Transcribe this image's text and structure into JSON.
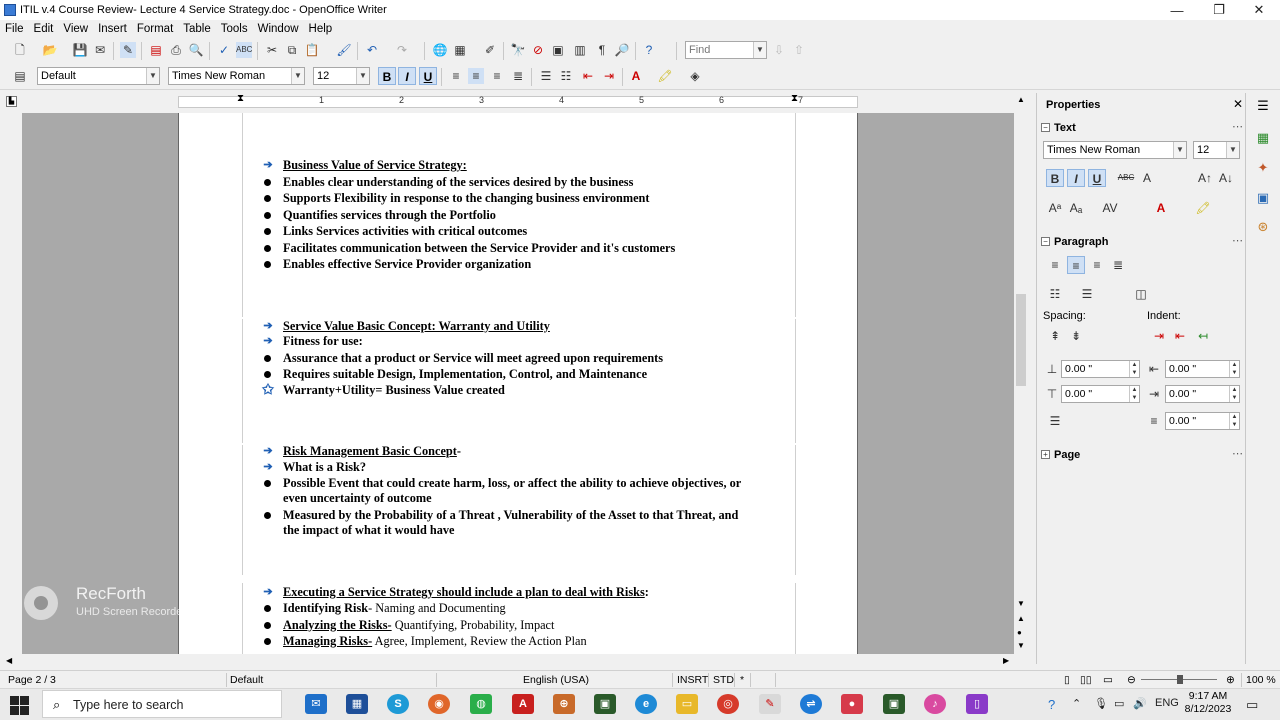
{
  "window": {
    "title": "ITIL v.4 Course Review- Lecture 4 Service Strategy.doc - OpenOffice Writer",
    "minimize": "—",
    "maximize": "❐",
    "close": "✕"
  },
  "menu": [
    "File",
    "Edit",
    "View",
    "Insert",
    "Format",
    "Table",
    "Tools",
    "Window",
    "Help"
  ],
  "toolbar": {
    "find_placeholder": "Find",
    "paragraph_style": "Default",
    "font_name": "Times New Roman",
    "font_size": "12",
    "bold": "B",
    "italic": "I",
    "underline": "U"
  },
  "ruler": {
    "ticks": [
      "1",
      "2",
      "3",
      "4",
      "5",
      "6",
      "7"
    ]
  },
  "document": {
    "sections": [
      {
        "heading": "Business Value of Service Strategy:",
        "items": [
          "Enables clear understanding of the services desired by the business",
          "Supports Flexibility in response to the changing business environment",
          "Quantifies services through the Portfolio",
          "Links Services activities with critical outcomes",
          "Facilitates communication between the Service Provider and it's customers",
          "Enables effective  Service Provider organization"
        ]
      },
      {
        "heading": "Service Value Basic Concept: Warranty and Utility",
        "sub": "Fitness for use:",
        "items": [
          "Assurance that a product or Service will meet agreed upon requirements",
          "Requires suitable Design, Implementation,  Control, and Maintenance"
        ],
        "star": "Warranty+Utility= Business Value created"
      },
      {
        "heading": "Risk Management Basic Concept",
        "heading_suffix": "-",
        "sub": "What is a Risk?",
        "items": [
          "Possible Event that could  create harm, loss, or affect the ability to achieve objectives, or",
          "even uncertainty of outcome",
          "Measured by the Probability of a Threat , Vulnerability of the Asset to that Threat, and",
          "the impact of what it would have"
        ]
      },
      {
        "heading": "Executing a Service Strategy should include a plan to deal with Risks",
        "heading_suffix": ":",
        "items": [
          {
            "term": "Identifying Risk",
            "rest": "- Naming and Documenting"
          },
          {
            "term": "Analyzing the Risks-",
            "rest": "  Quantifying, Probability, Impact"
          },
          {
            "term": "Managing Risks-",
            "rest": " Agree, Implement, Review the Action Plan"
          }
        ]
      }
    ]
  },
  "watermark": {
    "title": "RecForth",
    "subtitle": "UHD Screen Recorder"
  },
  "sidebar": {
    "title": "Properties",
    "text_section": "Text",
    "font_name": "Times New Roman",
    "font_size": "12",
    "paragraph_section": "Paragraph",
    "spacing_label": "Spacing:",
    "indent_label": "Indent:",
    "spacing_above": "0.00 \"",
    "spacing_below": "0.00 \"",
    "indent_before": "0.00 \"",
    "indent_after": "0.00 \"",
    "indent_first": "0.00 \"",
    "page_section": "Page"
  },
  "status": {
    "page": "Page 2 / 3",
    "style": "Default",
    "language": "English (USA)",
    "insert_mode": "INSRT",
    "selection_mode": "STD",
    "modified": "*",
    "zoom": "100 %"
  },
  "taskbar": {
    "search_placeholder": "Type here to search",
    "lang": "ENG",
    "time": "9:17 AM",
    "date": "8/12/2023"
  },
  "colors": {
    "accent": "#1f5fb4",
    "doc_background": "#a9a9a9",
    "active_button": "#cfe0f5"
  }
}
